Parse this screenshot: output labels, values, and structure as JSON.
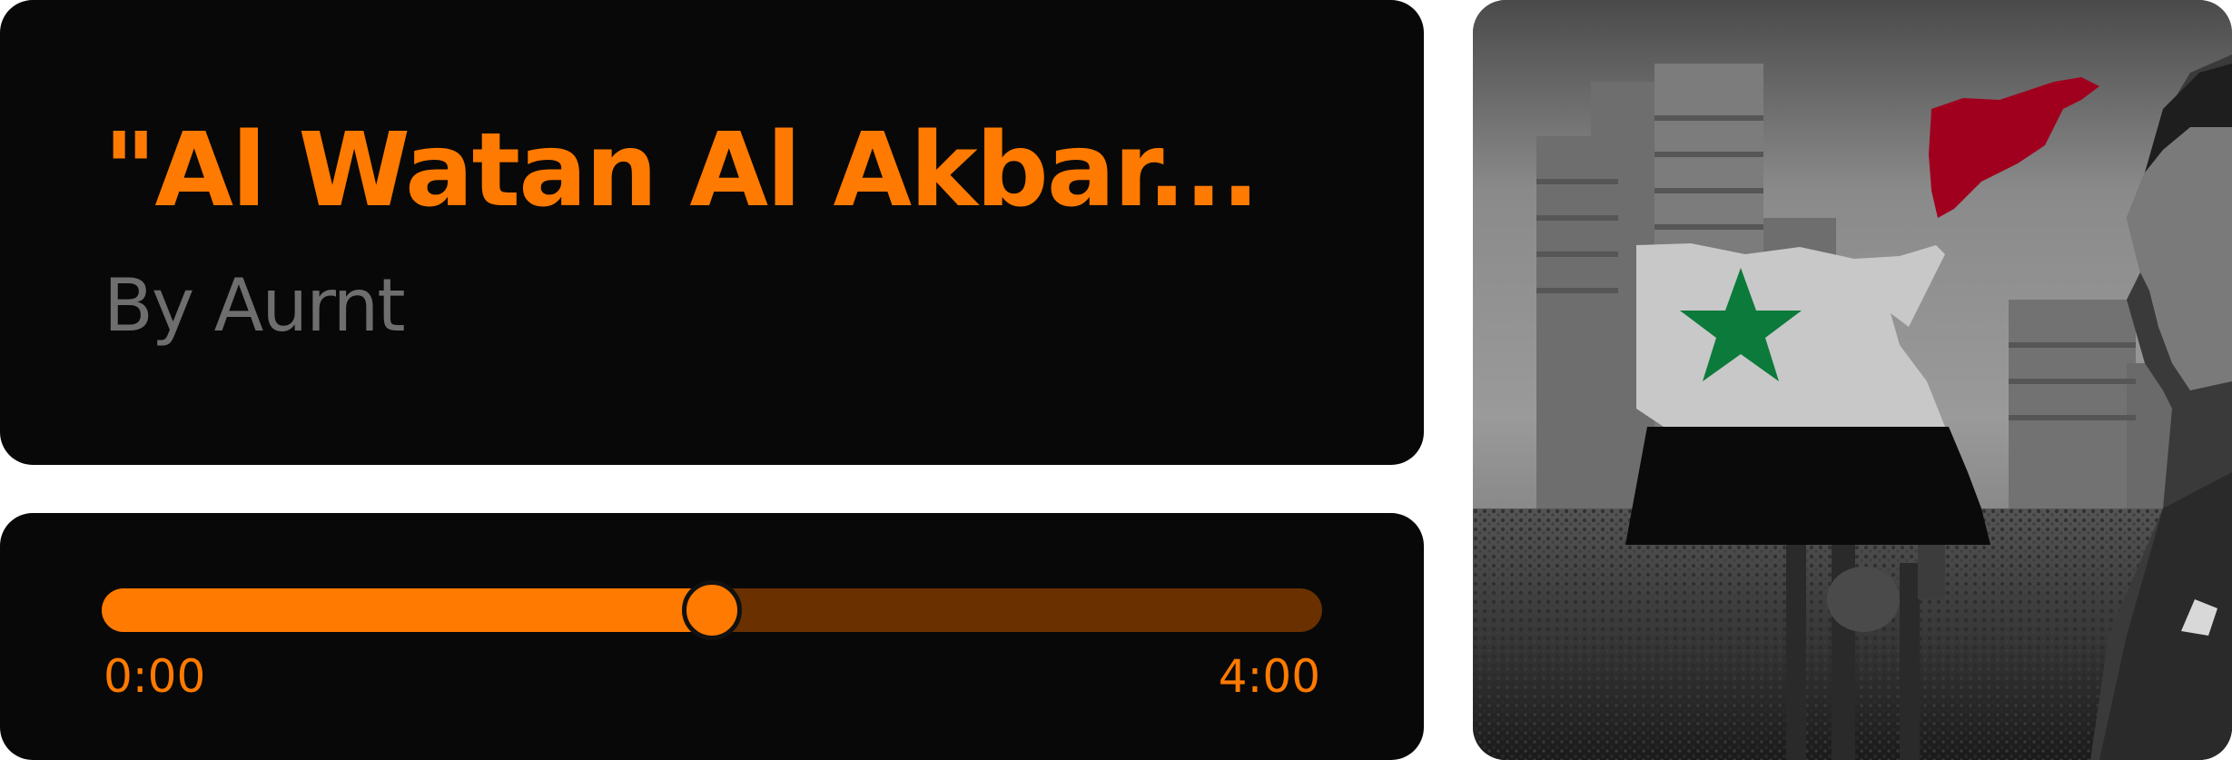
{
  "colors": {
    "accent": "#FF7A00",
    "track_bg": "#6A3000",
    "card_bg": "#080808",
    "artist_text": "#6E6E6E",
    "flag_red": "#A0001E",
    "flag_green": "#0B7A3A"
  },
  "song": {
    "title": "\"Al Watan Al Akbar...",
    "artist": "By Aurnt"
  },
  "player": {
    "current_time": "0:00",
    "total_time": "4:00",
    "progress": 0.5
  },
  "artwork": {
    "description_icon": "album-artwork"
  }
}
